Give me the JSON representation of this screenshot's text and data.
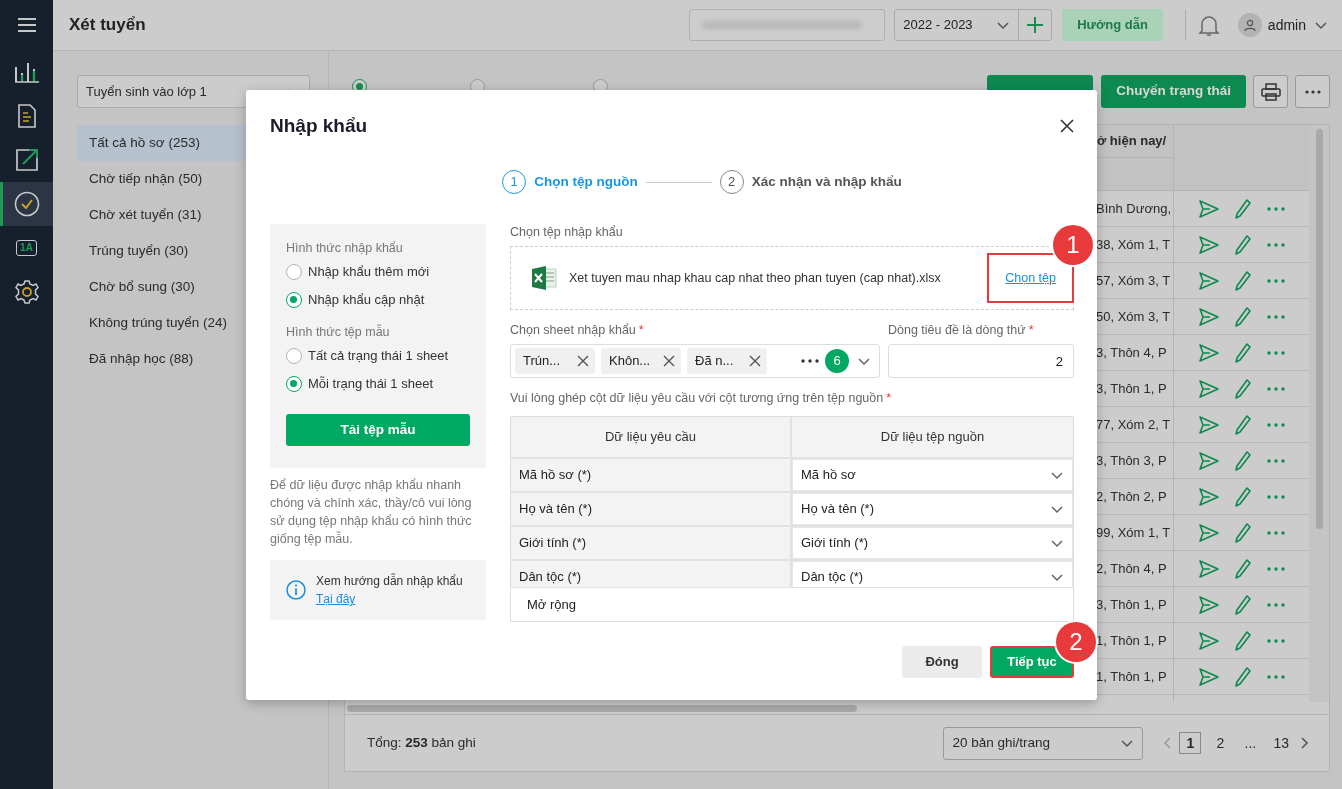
{
  "rail": {
    "items": [
      {
        "kind": "menu",
        "selected": false
      },
      {
        "kind": "chart",
        "selected": false
      },
      {
        "kind": "document",
        "selected": false
      },
      {
        "kind": "export",
        "selected": false
      },
      {
        "kind": "check",
        "selected": true
      },
      {
        "kind": "class",
        "text": "1A",
        "selected": false
      },
      {
        "kind": "settings",
        "selected": false
      }
    ]
  },
  "header": {
    "title": "Xét tuyển",
    "year": "2022 - 2023",
    "help_button": "Hướng dẫn",
    "user": "admin"
  },
  "left_panel": {
    "select": "Tuyển sinh vào lớp 1",
    "items": [
      {
        "label": "Tất cả hồ sơ (253)",
        "selected": true
      },
      {
        "label": "Chờ tiếp nhận (50)",
        "selected": false
      },
      {
        "label": "Chờ xét tuyển (31)",
        "selected": false
      },
      {
        "label": "Trúng tuyển (30)",
        "selected": false
      },
      {
        "label": "Chờ bổ sung (30)",
        "selected": false
      },
      {
        "label": "Không trúng tuyển (24)",
        "selected": false
      },
      {
        "label": "Đã nhập học (88)",
        "selected": false
      }
    ]
  },
  "filters": [
    {
      "selected": true
    },
    {
      "selected": false
    },
    {
      "selected": false
    }
  ],
  "toolbar": {
    "status_button": "Chuyển trạng thái"
  },
  "table": {
    "column_header": "ở hiện nay/",
    "rows": [
      {
        "address": "Bình Dương,"
      },
      {
        "address": "38, Xóm 1, T"
      },
      {
        "address": "57, Xóm 3, T"
      },
      {
        "address": "50, Xóm 3, T"
      },
      {
        "address": "3, Thôn 4, P"
      },
      {
        "address": "3, Thôn 1, P"
      },
      {
        "address": "77, Xóm 2, T"
      },
      {
        "address": "3, Thôn 3, P"
      },
      {
        "address": "2, Thôn 2, P"
      },
      {
        "address": "99, Xóm 1, T"
      },
      {
        "address": "2, Thôn 4, P"
      },
      {
        "address": "3, Thôn 1, P"
      },
      {
        "address": "1, Thôn 1, P"
      },
      {
        "address": "1, Thôn 1, P"
      }
    ]
  },
  "footer": {
    "total": "Tổng: **253** bản ghi",
    "page_size": "20 bản ghi/trang",
    "pages": [
      {
        "label": "1",
        "selected": true
      },
      {
        "label": "2",
        "selected": false
      },
      {
        "label": "...",
        "selected": false
      },
      {
        "label": "13",
        "selected": false
      }
    ]
  },
  "modal": {
    "title": "Nhập khẩu",
    "steps": [
      {
        "number": "1",
        "label": "Chọn tệp nguồn",
        "selected": true
      },
      {
        "number": "2",
        "label": "Xác nhận và nhập khẩu",
        "selected": false
      }
    ],
    "import_mode": {
      "label": "Hình thức nhập khẩu",
      "options": [
        {
          "label": "Nhập khẩu thêm mới",
          "selected": false
        },
        {
          "label": "Nhập khẩu cập nhật",
          "selected": true
        }
      ]
    },
    "template_mode": {
      "label": "Hình thức tệp mẫu",
      "options": [
        {
          "label": "Tất cả trạng thái 1 sheet",
          "selected": false
        },
        {
          "label": "Mỗi trạng thái 1 sheet",
          "selected": true
        }
      ]
    },
    "download_button": "Tải tệp mẫu",
    "note": "Để dữ liệu được nhập khẩu nhanh chóng và chính xác, thầy/cô vui lòng sử dụng tệp nhập khẩu có hình thức giống tệp mẫu.",
    "guide": {
      "text": "Xem hướng dẫn nhập khẩu",
      "link": "Tại đây"
    },
    "file": {
      "label": "Chọn tệp nhập khẩu",
      "name": "Xet tuyen mau nhap khau cap nhat theo phan tuyen (cap nhat).xlsx",
      "link": "Chọn tệp",
      "highlighted": true,
      "callout": "1"
    },
    "sheet": {
      "label": "Chọn sheet nhập khẩu",
      "required_mark": "*",
      "tags": [
        "Trún...",
        "Khôn...",
        "Đã n..."
      ],
      "count": "6"
    },
    "header_row": {
      "label": "Dòng tiêu đề là dòng thứ",
      "required_mark": "*",
      "value": "2"
    },
    "mapping": {
      "label": "Vui lòng ghép cột dữ liệu yêu cầu với cột tương ứng trên tệp nguồn",
      "required_mark": "*",
      "columns": [
        "Dữ liệu yêu cầu",
        "Dữ liệu tệp nguồn"
      ],
      "rows": [
        {
          "required_field": "Mã hồ sơ (*)",
          "source_field": "Mã hồ sơ"
        },
        {
          "required_field": "Họ và tên (*)",
          "source_field": "Họ và tên (*)"
        },
        {
          "required_field": "Giới tính (*)",
          "source_field": "Giới tính (*)"
        },
        {
          "required_field": "Dân tộc (*)",
          "source_field": "Dân tộc (*)"
        }
      ],
      "expand_link": "Mở rộng"
    },
    "buttons": [
      {
        "label": "Đóng",
        "kind": "secondary",
        "highlighted": false
      },
      {
        "label": "Tiếp tục",
        "kind": "primary",
        "highlighted": true,
        "callout": "2"
      }
    ]
  }
}
